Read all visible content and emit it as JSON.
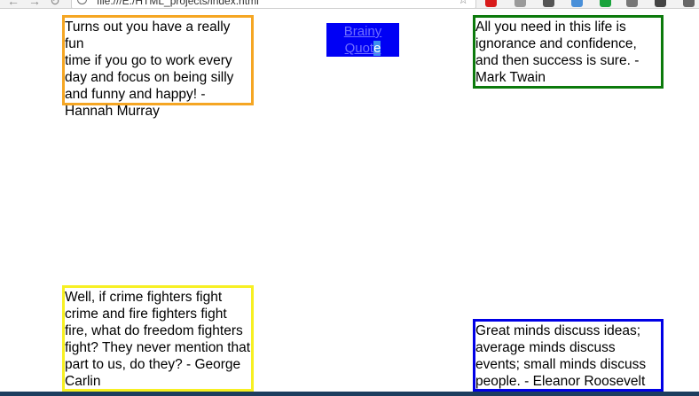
{
  "browser": {
    "url": "file:///E:/HTML_projects/index.html",
    "back_glyph": "←",
    "forward_glyph": "→",
    "reload_glyph": "↻",
    "star_glyph": "☆",
    "extensions": [
      {
        "name": "opera-icon",
        "color": "#d81a1a"
      },
      {
        "name": "extension-icon-gray",
        "color": "#9a9a9a"
      },
      {
        "name": "extension-icon-person",
        "color": "#555555"
      },
      {
        "name": "extension-icon-blue",
        "color": "#4a90d9"
      },
      {
        "name": "extension-icon-green",
        "color": "#1aa33c"
      },
      {
        "name": "extension-icon-gear",
        "color": "#777777"
      },
      {
        "name": "extension-icon-dark",
        "color": "#444444"
      },
      {
        "name": "menu-icon",
        "color": "#666666"
      }
    ]
  },
  "brand": {
    "line1": "Brainy",
    "line2_prefix": "Quot",
    "line2_selected": "e"
  },
  "quotes": [
    {
      "border_color": "#f5a623",
      "lines": [
        "Turns out you have a really fun",
        "time if you go to work every",
        "day and focus on being silly",
        "and funny and happy! -",
        "Hannah Murray"
      ]
    },
    {
      "border_color": "#0c7a0c",
      "lines": [
        "All you need in this life is",
        "ignorance and confidence,",
        "and then success is sure. -",
        "Mark Twain"
      ]
    },
    {
      "border_color": "#f7f022",
      "lines": [
        "Well, if crime fighters fight",
        "crime and fire fighters fight",
        "fire, what do freedom fighters",
        "fight? They never mention that",
        "part to us, do they? - George",
        "Carlin"
      ]
    },
    {
      "border_color": "#0000e6",
      "lines": [
        "Great minds discuss ideas;",
        "average minds discuss",
        "events; small minds discuss",
        "people. - Eleanor Roosevelt"
      ]
    }
  ]
}
